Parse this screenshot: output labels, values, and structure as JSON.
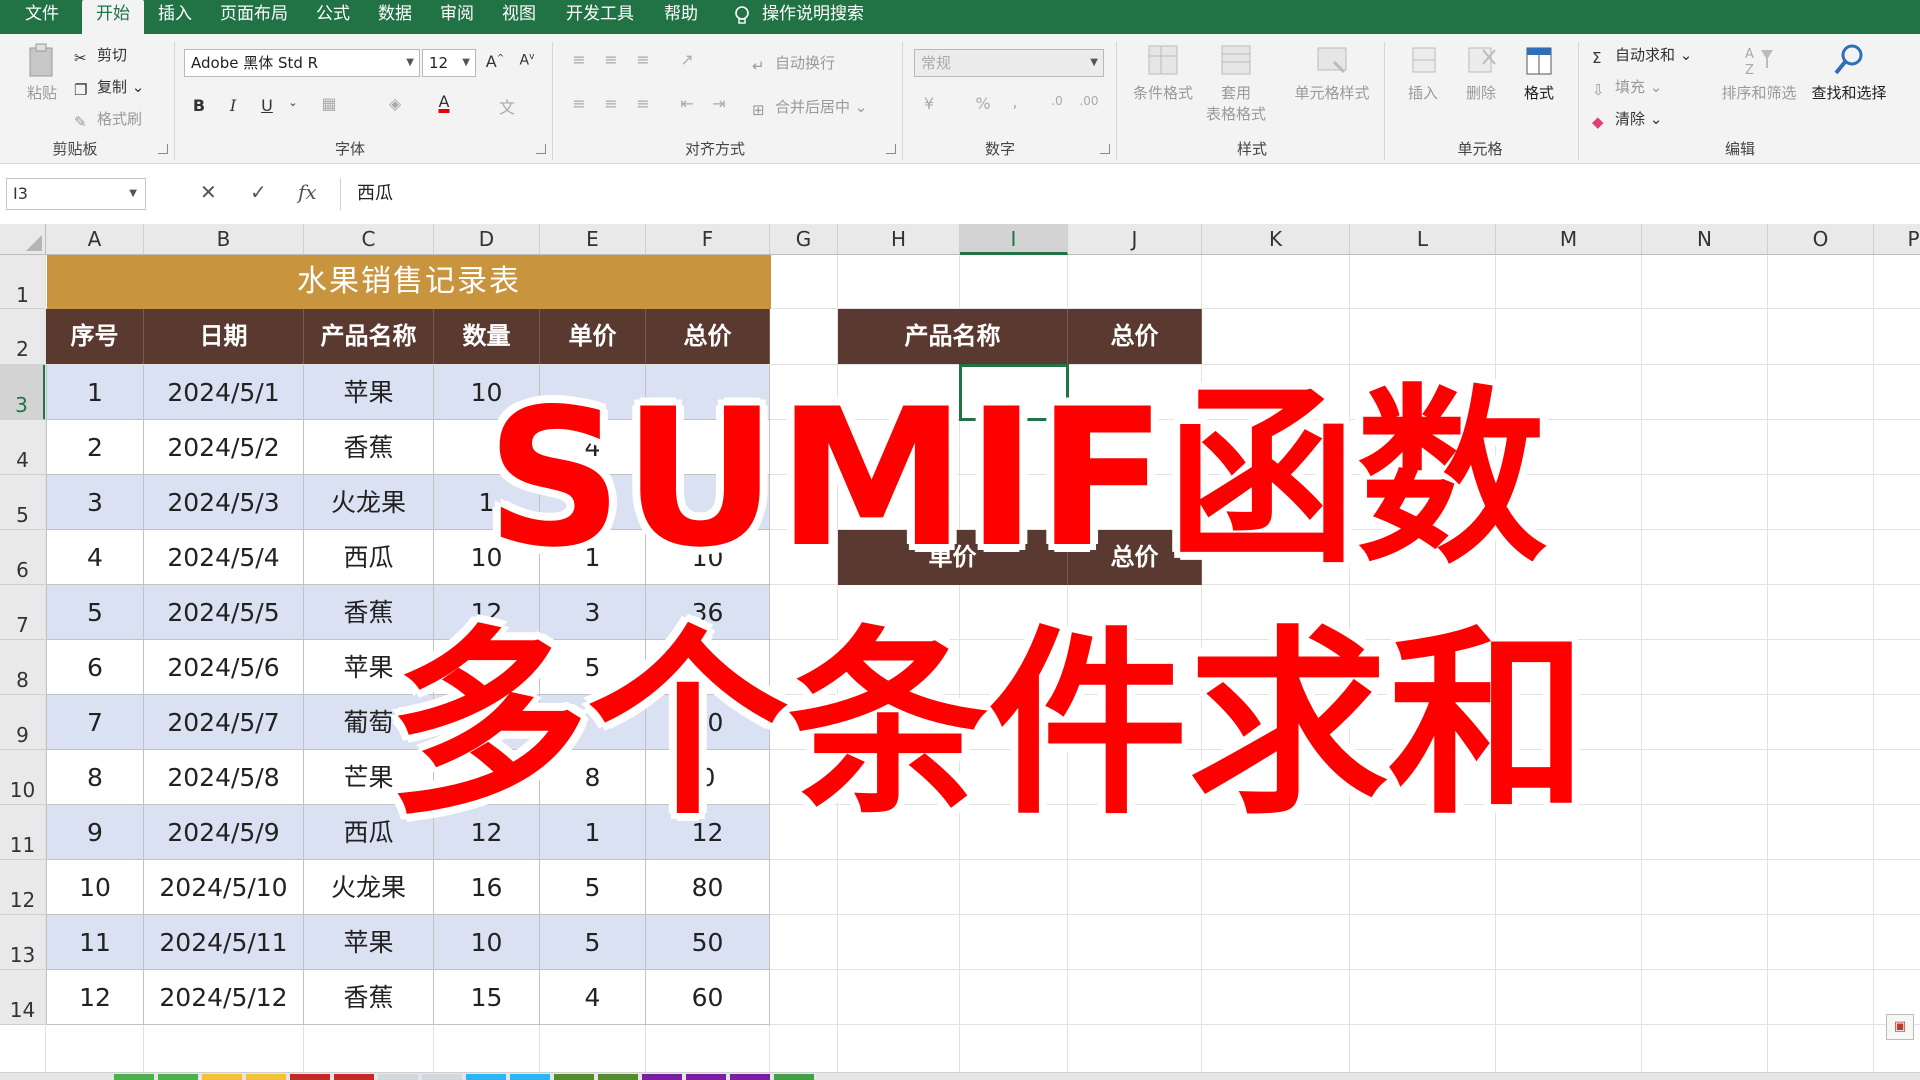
{
  "ribbon_tabs": [
    {
      "label": "文件"
    },
    {
      "label": "开始"
    },
    {
      "label": "插入"
    },
    {
      "label": "页面布局"
    },
    {
      "label": "公式"
    },
    {
      "label": "数据"
    },
    {
      "label": "审阅"
    },
    {
      "label": "视图"
    },
    {
      "label": "开发工具"
    },
    {
      "label": "帮助"
    }
  ],
  "active_tab": "开始",
  "tell_me": "操作说明搜索",
  "clipboard": {
    "paste": "粘贴",
    "cut": "剪切",
    "copy": "复制",
    "format_painter": "格式刷",
    "group": "剪贴板"
  },
  "font": {
    "name": "Adobe 黑体 Std R",
    "size": "12",
    "bold": "B",
    "italic": "I",
    "underline": "U",
    "grow": "A",
    "shrink": "A",
    "color_letter": "A",
    "group": "字体"
  },
  "alignment": {
    "wrap": "自动换行",
    "merge": "合并后居中",
    "group": "对齐方式"
  },
  "number": {
    "format": "常规",
    "percent": "%",
    "comma": ",",
    "group": "数字"
  },
  "styles": {
    "conditional": "条件格式",
    "table_line1": "套用",
    "table_line2": "表格格式",
    "cell_styles": "单元格样式",
    "group": "样式"
  },
  "cells": {
    "insert": "插入",
    "delete": "删除",
    "format": "格式",
    "group": "单元格"
  },
  "editing": {
    "autosum": "自动求和",
    "fill": "填充",
    "clear": "清除",
    "sort": "排序和筛选",
    "find": "查找和选择",
    "group": "编辑"
  },
  "formula_bar": {
    "name_box": "I3",
    "cancel": "✕",
    "enter": "✓",
    "fx": "fx",
    "content": "西瓜"
  },
  "columns": [
    "A",
    "B",
    "C",
    "D",
    "E",
    "F",
    "G",
    "H",
    "I",
    "J",
    "K",
    "L",
    "M",
    "N",
    "O",
    "P"
  ],
  "rows": [
    "1",
    "2",
    "3",
    "4",
    "5",
    "6",
    "7",
    "8",
    "9",
    "10",
    "11",
    "12",
    "13",
    "14"
  ],
  "sheet": {
    "title": "水果销售记录表",
    "headers": [
      "序号",
      "日期",
      "产品名称",
      "数量",
      "单价",
      "总价"
    ],
    "records": [
      [
        "1",
        "2024/5/1",
        "苹果",
        "10",
        "",
        ""
      ],
      [
        "2",
        "2024/5/2",
        "香蕉",
        "",
        "4",
        ""
      ],
      [
        "3",
        "2024/5/3",
        "火龙果",
        "1",
        "",
        ""
      ],
      [
        "4",
        "2024/5/4",
        "西瓜",
        "10",
        "1",
        "10"
      ],
      [
        "5",
        "2024/5/5",
        "香蕉",
        "12",
        "3",
        "36"
      ],
      [
        "6",
        "2024/5/6",
        "苹果",
        "",
        "5",
        ""
      ],
      [
        "7",
        "2024/5/7",
        "葡萄",
        "",
        "",
        "20"
      ],
      [
        "8",
        "2024/5/8",
        "芒果",
        "",
        "8",
        "0"
      ],
      [
        "9",
        "2024/5/9",
        "西瓜",
        "12",
        "1",
        "12"
      ],
      [
        "10",
        "2024/5/10",
        "火龙果",
        "16",
        "5",
        "80"
      ],
      [
        "11",
        "2024/5/11",
        "苹果",
        "10",
        "5",
        "50"
      ],
      [
        "12",
        "2024/5/12",
        "香蕉",
        "15",
        "4",
        "60"
      ]
    ],
    "side_headers_1": [
      "产品名称",
      "总价"
    ],
    "side_headers_2": [
      "单价",
      "总价"
    ]
  },
  "overlay": {
    "line1": "SUMIF函数",
    "line2": "多个条件求和"
  },
  "colors": {
    "excel_green": "#217346",
    "title_fill": "#c9943e",
    "header_fill": "#5a3a30",
    "band_fill": "#d9e1f2",
    "overlay_red": "#ff0000"
  }
}
